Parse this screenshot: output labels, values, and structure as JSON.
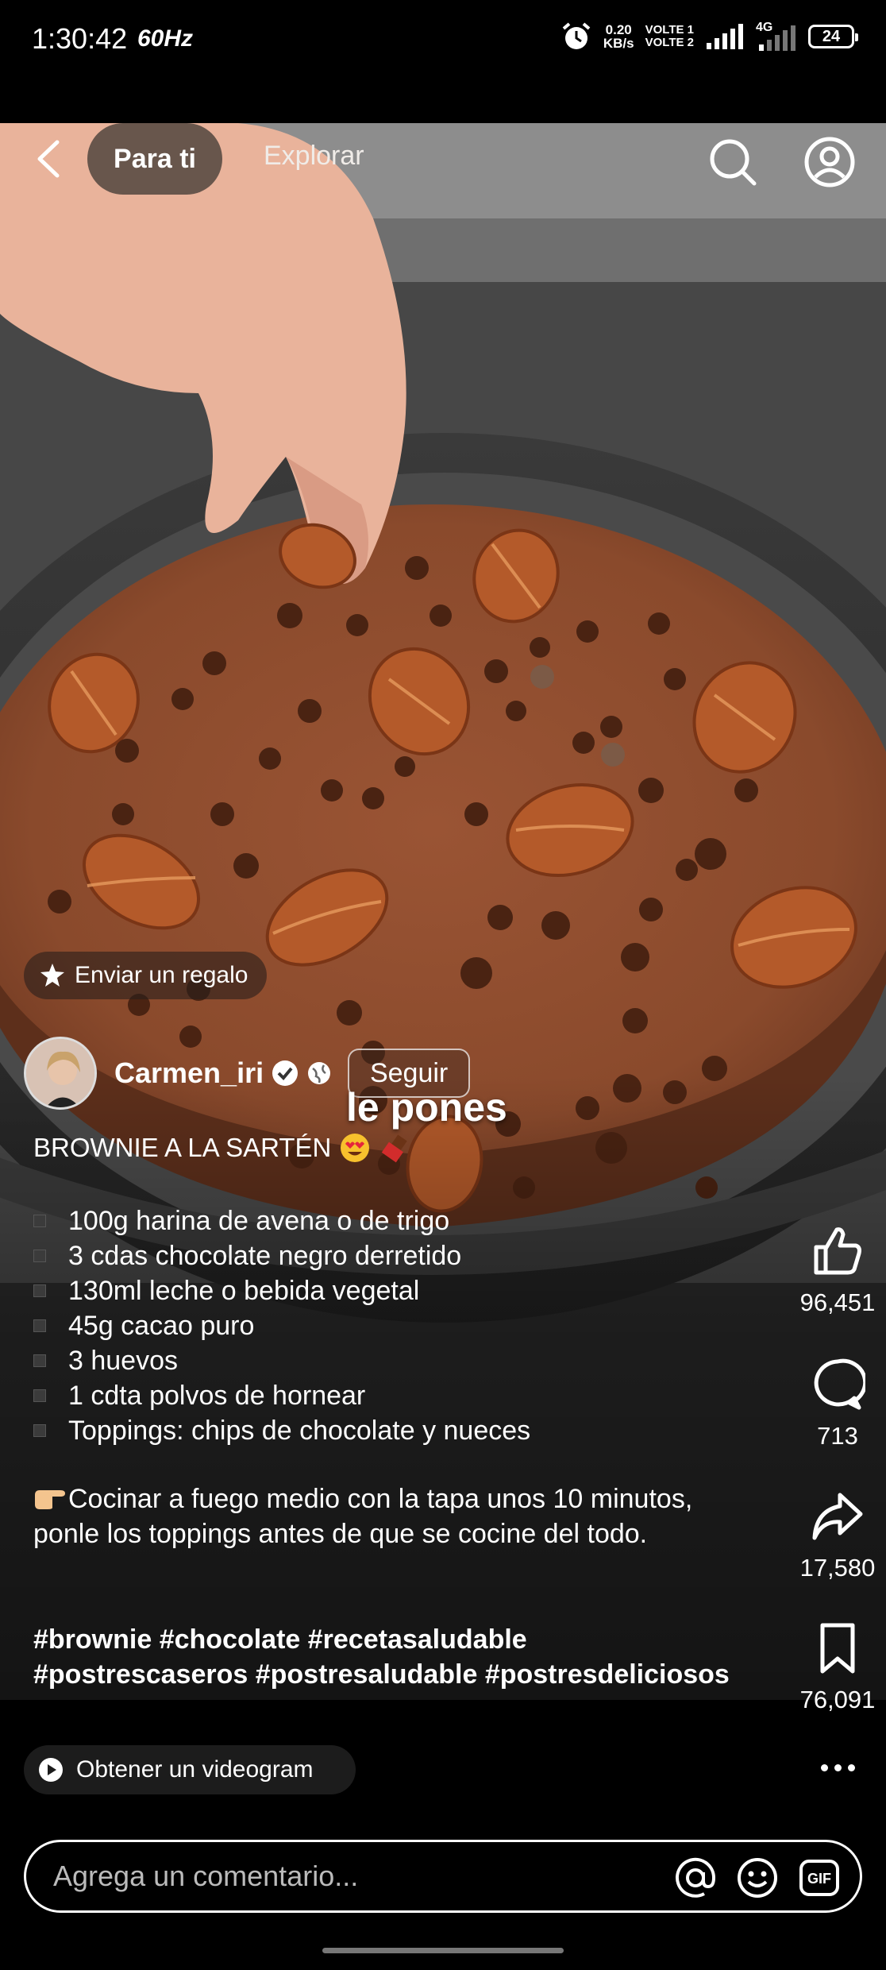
{
  "status_bar": {
    "time": "1:30:42",
    "refresh": "60Hz",
    "speed_value": "0.20",
    "speed_unit": "KB/s",
    "volte_1": "VOLTE 1",
    "volte_2": "VOLTE 2",
    "network": "4G",
    "battery": "24"
  },
  "top_nav": {
    "tab_active": "Para ti",
    "tab_other": "Explorar"
  },
  "video": {
    "caption": "le pones"
  },
  "gift": {
    "label": "Enviar un regalo"
  },
  "author": {
    "name": "Carmen_iri",
    "follow_label": "Seguir"
  },
  "post": {
    "title": "BROWNIE A LA SARTÉN",
    "ingredients": [
      "100g harina de avena o de trigo",
      "3 cdas chocolate negro derretido",
      "130ml leche o bebida vegetal",
      "45g cacao puro",
      "3 huevos",
      "1 cdta polvos de hornear",
      "Toppings: chips de chocolate y nueces"
    ],
    "instructions": "Cocinar a fuego medio con la tapa unos 10 minutos, ponle los toppings antes de que se cocine del todo.",
    "hashtags": "#brownie #chocolate #recetasaludable #postrescaseros #postresaludable #postresdeliciosos"
  },
  "actions": {
    "likes": "96,451",
    "comments": "713",
    "shares": "17,580",
    "saves": "76,091"
  },
  "videogram": {
    "label": "Obtener un videogram"
  },
  "comment": {
    "placeholder": "Agrega un comentario..."
  },
  "colors": {
    "background": "#000000",
    "pill_active": "#5a4b44",
    "text": "#ffffff",
    "brownie": "#8a4a2c"
  }
}
